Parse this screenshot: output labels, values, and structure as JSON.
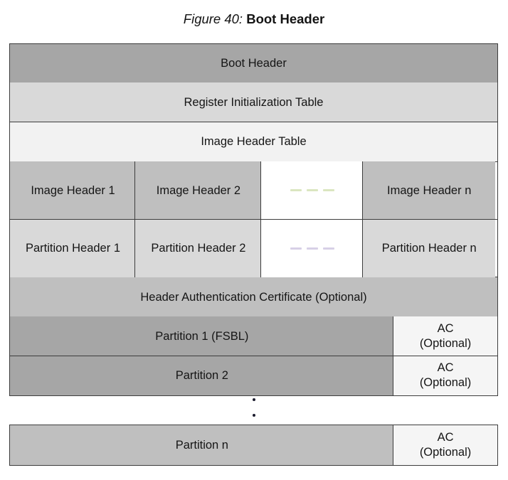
{
  "figure": {
    "label": "Figure 40:",
    "title": "Boot Header"
  },
  "colors": {
    "fill_dark": "#a6a6a6",
    "fill_mid": "#bfbfbf",
    "fill_light": "#d9d9d9",
    "fill_pale": "#f2f2f2",
    "fill_ac": "#f5f5f5",
    "fill_white": "#ffffff",
    "border": "#3d3d3d",
    "text": "#151515",
    "dash_green": "#dae6c0",
    "dash_lavender": "#d7d0e6"
  },
  "diagram": {
    "rows": {
      "boot_header": "Boot Header",
      "register_initialization_table": "Register Initialization Table",
      "image_header_table": "Image Header Table",
      "image_headers": [
        "Image Header 1",
        "Image Header 2",
        "",
        "Image Header n"
      ],
      "partition_headers": [
        "Partition Header 1",
        "Partition Header 2",
        "",
        "Partition Header n"
      ],
      "header_authentication_certificate": "Header Authentication Certificate (Optional)",
      "partitions": [
        {
          "name": "Partition 1 (FSBL)",
          "ac_line1": "AC",
          "ac_line2": "(Optional)"
        },
        {
          "name": "Partition 2",
          "ac_line1": "AC",
          "ac_line2": "(Optional)"
        },
        {
          "name": "Partition n",
          "ac_line1": "AC",
          "ac_line2": "(Optional)"
        }
      ]
    }
  }
}
